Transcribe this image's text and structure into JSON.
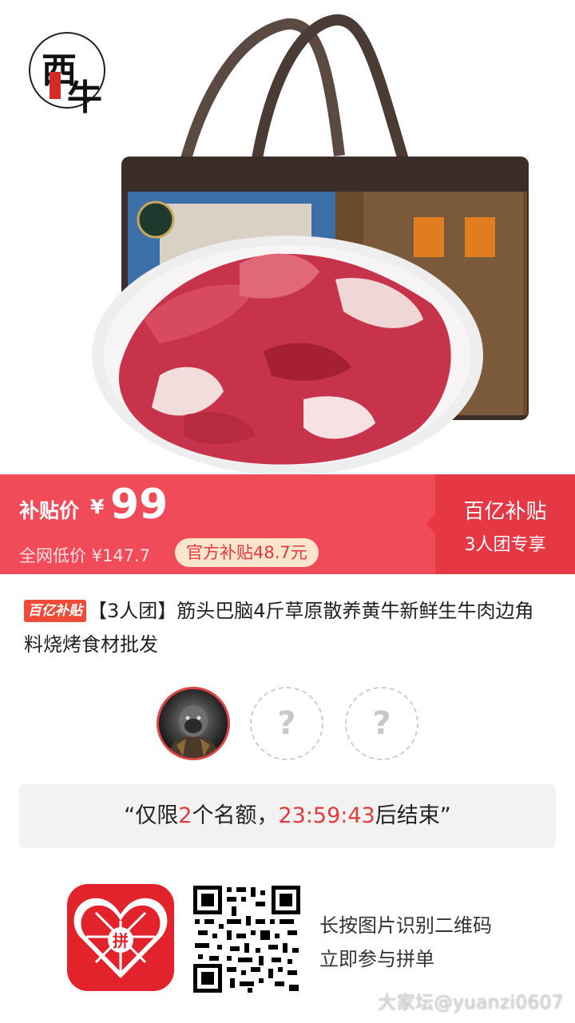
{
  "product_image": {
    "logo_text": [
      "西",
      "牛"
    ],
    "description_icon": "beef-in-gift-bag-image"
  },
  "price_banner": {
    "label": "补贴价",
    "currency": "¥",
    "price": "99",
    "network_low_label": "全网低价 ¥147.7",
    "subsidy_pill": "官方补贴48.7元",
    "right_title": "百亿补贴",
    "right_subtitle": "3人团专享",
    "colors": {
      "banner": "#f14b5a",
      "banner_right": "#e63744",
      "pill_bg": "#fde4cd"
    }
  },
  "title": {
    "badge": "百亿补贴",
    "text": "【3人团】筋头巴脑4斤草原散养黄牛新鲜生牛肉边角料烧烤食材批发"
  },
  "group": {
    "empty_slot_symbol": "?",
    "slots_total": 3,
    "slots_filled": 1
  },
  "notice": {
    "prefix": "“仅限",
    "count": "2",
    "middle": "个名额，",
    "countdown": "23:59:43",
    "suffix": "后结束”"
  },
  "footer": {
    "app_logo_text": "拼",
    "hint_line1": "长按图片识别二维码",
    "hint_line2": "立即参与拼单",
    "watermark": "大家坛@yuanzi0607"
  }
}
